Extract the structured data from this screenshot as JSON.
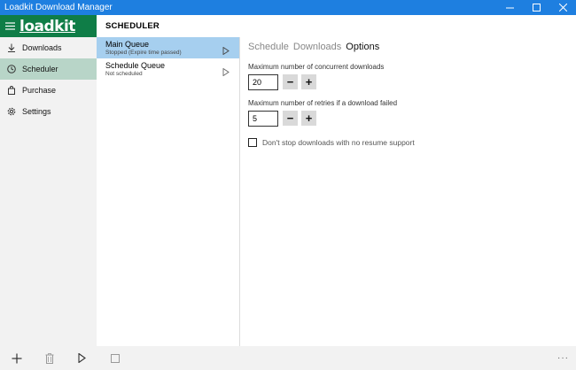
{
  "window": {
    "title": "Loadkit Download Manager"
  },
  "brand": {
    "logo_text": "loadkit"
  },
  "sidebar": {
    "items": [
      {
        "label": "Downloads",
        "icon": "download-icon"
      },
      {
        "label": "Scheduler",
        "icon": "clock-icon",
        "active": true
      },
      {
        "label": "Purchase",
        "icon": "bag-icon"
      },
      {
        "label": "Settings",
        "icon": "gear-icon"
      }
    ]
  },
  "header": {
    "title": "SCHEDULER"
  },
  "queues": [
    {
      "name": "Main Queue",
      "status": "Stopped (Expire time passed)",
      "selected": true
    },
    {
      "name": "Schedule Queue",
      "status": "Not scheduled",
      "selected": false
    }
  ],
  "tabs": [
    {
      "label": "Schedule",
      "active": false
    },
    {
      "label": "Downloads",
      "active": false
    },
    {
      "label": "Options",
      "active": true
    }
  ],
  "options": {
    "concurrent_label": "Maximum number of concurrent downloads",
    "concurrent_value": "20",
    "retries_label": "Maximum number of retries if a download failed",
    "retries_value": "5",
    "minus": "−",
    "plus": "+",
    "resume_checkbox_label": "Don't stop downloads with no resume support",
    "resume_checked": false
  },
  "bottombar": {
    "more": "···"
  },
  "colors": {
    "titlebar": "#1e7fe0",
    "brand": "#0f7d47",
    "nav_active": "#b8d5c8",
    "queue_selected": "#a6cfef"
  }
}
